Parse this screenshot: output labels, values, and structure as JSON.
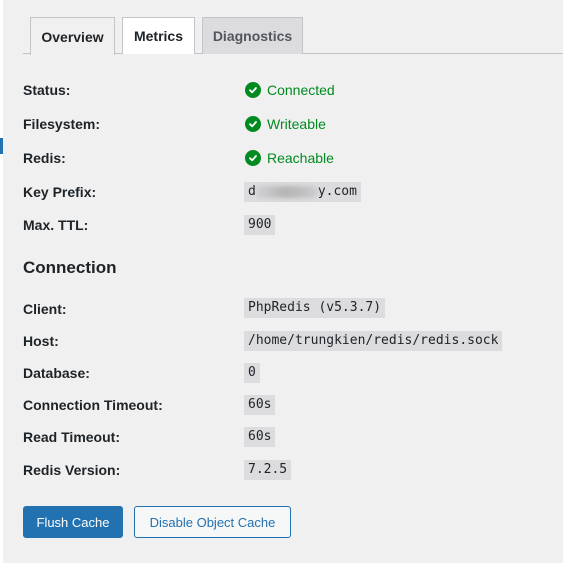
{
  "tabs": [
    {
      "label": "Overview",
      "active": true
    },
    {
      "label": "Metrics",
      "active": false
    },
    {
      "label": "Diagnostics",
      "active": false
    }
  ],
  "status_rows": [
    {
      "label": "Status:",
      "value": "Connected",
      "icon": "check-circle-icon"
    },
    {
      "label": "Filesystem:",
      "value": "Writeable",
      "icon": "check-circle-icon"
    },
    {
      "label": "Redis:",
      "value": "Reachable",
      "icon": "check-circle-icon"
    }
  ],
  "key_prefix": {
    "label": "Key Prefix:",
    "value_start": "d",
    "value_end": "y.com"
  },
  "max_ttl": {
    "label": "Max. TTL:",
    "value": "900"
  },
  "connection": {
    "heading": "Connection",
    "rows": [
      {
        "label": "Client:",
        "value": "PhpRedis (v5.3.7)"
      },
      {
        "label": "Host:",
        "value": "/home/trungkien/redis/redis.sock"
      },
      {
        "label": "Database:",
        "value": "0"
      },
      {
        "label": "Connection Timeout:",
        "value": "60s"
      },
      {
        "label": "Read Timeout:",
        "value": "60s"
      },
      {
        "label": "Redis Version:",
        "value": "7.2.5"
      }
    ]
  },
  "buttons": {
    "flush": "Flush Cache",
    "disable": "Disable Object Cache"
  },
  "colors": {
    "accent": "#2271b1",
    "success": "#008a20",
    "background": "#f0f0f1"
  }
}
